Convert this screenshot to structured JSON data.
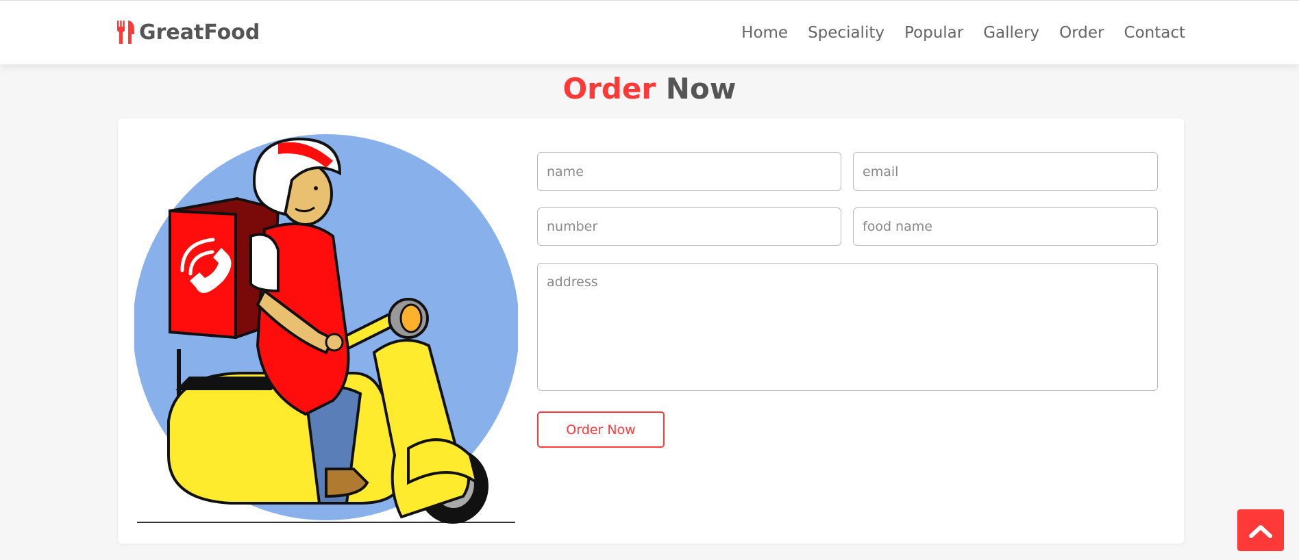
{
  "brand": {
    "name": "GreatFood",
    "logo_icon": "utensils-icon",
    "accent_color": "#ff3838"
  },
  "nav": {
    "items": [
      "Home",
      "Speciality",
      "Popular",
      "Gallery",
      "Order",
      "Contact"
    ]
  },
  "heading": {
    "accent": "Order",
    "rest": " Now"
  },
  "form": {
    "name_placeholder": "name",
    "email_placeholder": "email",
    "number_placeholder": "number",
    "food_placeholder": "food name",
    "address_placeholder": "address",
    "submit_label": "Order Now"
  },
  "illustration": {
    "subject": "delivery-scooter-illustration"
  },
  "back_to_top": {
    "icon": "chevron-up-icon"
  }
}
